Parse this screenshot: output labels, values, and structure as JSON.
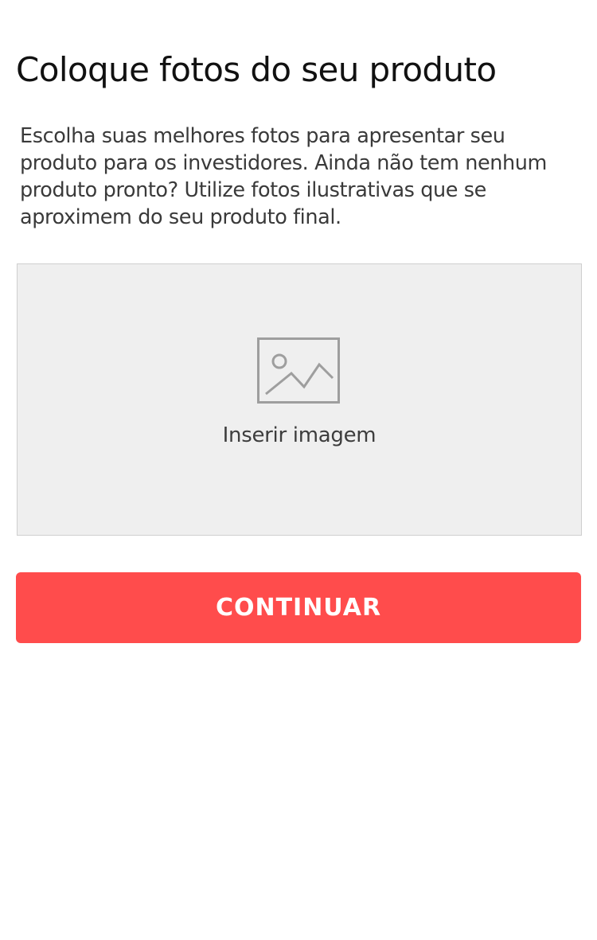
{
  "colors": {
    "primary_button": "#ff4c4c",
    "upload_background": "#efefef",
    "upload_border": "#cfcfcf",
    "icon_stroke": "#9e9e9e"
  },
  "header": {
    "title": "Coloque fotos do seu produto"
  },
  "main": {
    "description": "Escolha suas melhores fotos para apresentar seu produto para os investidores. Ainda não tem nenhum produto pronto? Utilize fotos ilustrativas que se aproximem do seu produto final.",
    "upload": {
      "icon": "image-placeholder-icon",
      "label": "Inserir imagem"
    },
    "continue_label": "CONTINUAR"
  }
}
